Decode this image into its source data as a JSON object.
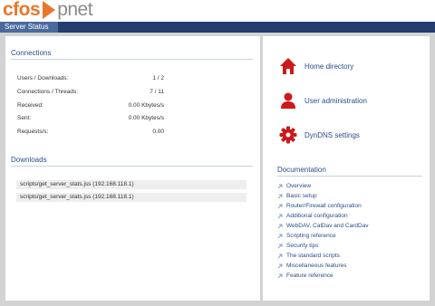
{
  "brand": {
    "part1": "cfos",
    "part2": "pnet"
  },
  "nav": {
    "tab": "Server Status"
  },
  "connections": {
    "title": "Connections",
    "rows": [
      {
        "label": "Users / Downloads:",
        "value": "1 / 2"
      },
      {
        "label": "Connections / Threads:",
        "value": "7 / 11"
      },
      {
        "label": "Received:",
        "value": "0.00 Kbytes/s"
      },
      {
        "label": "Sent:",
        "value": "0.00 Kbytes/s"
      },
      {
        "label": "Requests/s:",
        "value": "0.00"
      }
    ]
  },
  "downloads": {
    "title": "Downloads",
    "rows": [
      "scripts/get_server_stats.jss (192.168.118.1)",
      "scripts/get_server_stats.jss (192.168.118.1)"
    ]
  },
  "actions": [
    {
      "label": "Home directory",
      "icon": "home-icon",
      "color": "#cc1a1a"
    },
    {
      "label": "User administration",
      "icon": "user-icon",
      "color": "#cc1a1a"
    },
    {
      "label": "DynDNS settings",
      "icon": "gear-icon",
      "color": "#cc1a1a"
    }
  ],
  "documentation": {
    "title": "Documentation",
    "items": [
      "Overview",
      "Basic setup",
      "Router/Firewall configuration",
      "Additional configuration",
      "WebDAV, CalDav and CardDav",
      "Scripting reference",
      "Security tips",
      "The standard scripts",
      "Miscellaneous features",
      "Feature reference"
    ]
  }
}
